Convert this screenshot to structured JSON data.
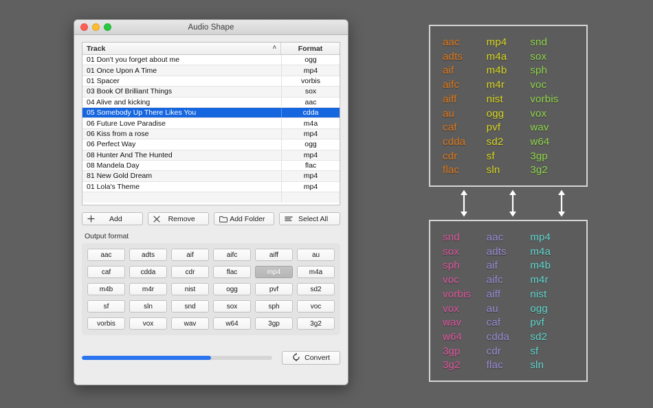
{
  "window": {
    "title": "Audio Shape",
    "traffic_lights": [
      "close-button",
      "minimize-button",
      "zoom-button"
    ]
  },
  "table": {
    "columns": [
      "Track",
      "Format"
    ],
    "sort_indicator": "˄",
    "rows": [
      {
        "track": "01 Don't you forget about me",
        "format": "ogg",
        "selected": false
      },
      {
        "track": "01 Once Upon A Time",
        "format": "mp4",
        "selected": false
      },
      {
        "track": "01 Spacer",
        "format": "vorbis",
        "selected": false
      },
      {
        "track": "03 Book Of Brilliant Things",
        "format": "sox",
        "selected": false
      },
      {
        "track": "04 Alive and kicking",
        "format": "aac",
        "selected": false
      },
      {
        "track": "05 Somebody Up There Likes You",
        "format": "cdda",
        "selected": true
      },
      {
        "track": "06 Future Love Paradise",
        "format": "m4a",
        "selected": false
      },
      {
        "track": "06 Kiss from a rose",
        "format": "mp4",
        "selected": false
      },
      {
        "track": "06 Perfect Way",
        "format": "ogg",
        "selected": false
      },
      {
        "track": "08 Hunter And The Hunted",
        "format": "mp4",
        "selected": false
      },
      {
        "track": "08 Mandela Day",
        "format": "flac",
        "selected": false
      },
      {
        "track": "81 New Gold Dream",
        "format": "mp4",
        "selected": false
      },
      {
        "track": "01 Lola's Theme",
        "format": "mp4",
        "selected": false
      }
    ],
    "selection_color": "#1666e0"
  },
  "toolbar": {
    "buttons": [
      {
        "label": "Add",
        "icon": "plus-icon"
      },
      {
        "label": "Remove",
        "icon": "cross-icon"
      },
      {
        "label": "Add Folder",
        "icon": "folder-icon"
      },
      {
        "label": "Select All",
        "icon": "lines-icon"
      }
    ]
  },
  "output_format": {
    "label": "Output format",
    "selected": "mp4",
    "options": [
      "aac",
      "adts",
      "aif",
      "aifc",
      "aiff",
      "au",
      "caf",
      "cdda",
      "cdr",
      "flac",
      "mp4",
      "m4a",
      "m4b",
      "m4r",
      "nist",
      "ogg",
      "pvf",
      "sd2",
      "sf",
      "sln",
      "snd",
      "sox",
      "sph",
      "voc",
      "vorbis",
      "vox",
      "wav",
      "w64",
      "3gp",
      "3g2"
    ]
  },
  "footer": {
    "progress_percent": 68,
    "progress_color": "#2a74ef",
    "convert_label": "Convert",
    "convert_icon": "refresh-icon"
  },
  "panels": [
    {
      "id": "panel-top",
      "columns": [
        {
          "color": "#e07818",
          "items": [
            "aac",
            "adts",
            "aif",
            "aifc",
            "aiff",
            "au",
            "caf",
            "cdda",
            "cdr",
            "flac"
          ]
        },
        {
          "color": "#d8d820",
          "items": [
            "mp4",
            "m4a",
            "m4b",
            "m4r",
            "nist",
            "ogg",
            "pvf",
            "sd2",
            "sf",
            "sln"
          ]
        },
        {
          "color": "#8fd84a",
          "items": [
            "snd",
            "sox",
            "sph",
            "voc",
            "vorbis",
            "vox",
            "wav",
            "w64",
            "3gp",
            "3g2"
          ]
        }
      ]
    },
    {
      "id": "panel-bottom",
      "columns": [
        {
          "color": "#e0559e",
          "items": [
            "snd",
            "sox",
            "sph",
            "voc",
            "vorbis",
            "vox",
            "wav",
            "w64",
            "3gp",
            "3g2"
          ]
        },
        {
          "color": "#9b8bd4",
          "items": [
            "aac",
            "adts",
            "aif",
            "aifc",
            "aiff",
            "au",
            "caf",
            "cdda",
            "cdr",
            "flac"
          ]
        },
        {
          "color": "#5fd8ce",
          "items": [
            "mp4",
            "m4a",
            "m4b",
            "m4r",
            "nist",
            "ogg",
            "pvf",
            "sd2",
            "sf",
            "sln"
          ]
        }
      ]
    }
  ],
  "arrows": {
    "color": "#ffffff",
    "count": 3,
    "positions": [
      44,
      115,
      186
    ]
  }
}
